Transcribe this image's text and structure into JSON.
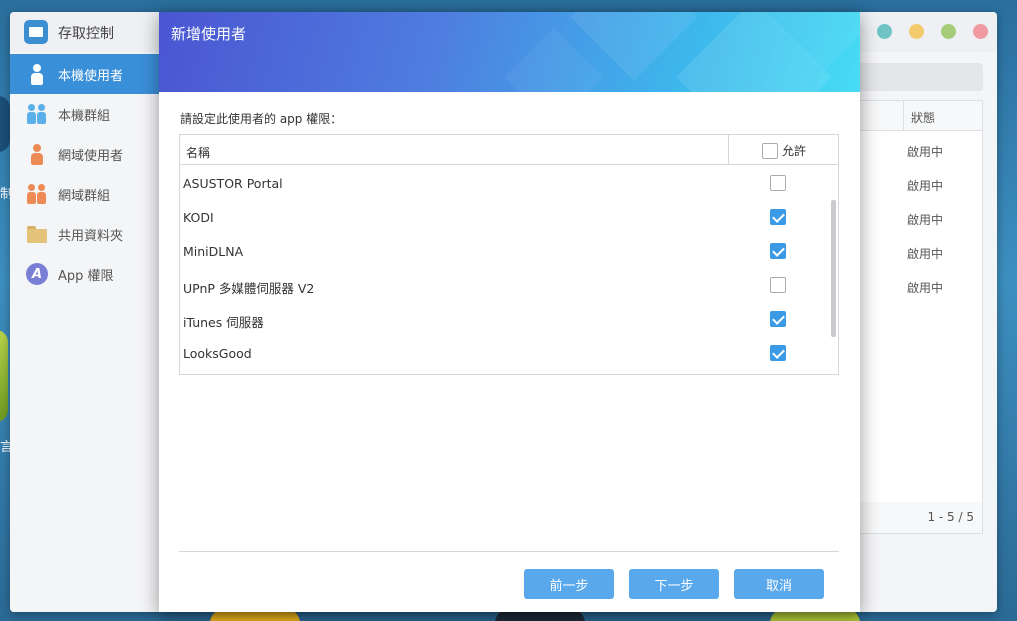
{
  "background_window": {
    "title": "存取控制",
    "sidebar": [
      {
        "label": "本機使用者",
        "icon": "user-icon",
        "active": true
      },
      {
        "label": "本機群組",
        "icon": "group-icon",
        "active": false
      },
      {
        "label": "網域使用者",
        "icon": "domain-user-icon",
        "active": false
      },
      {
        "label": "網域群組",
        "icon": "domain-group-icon",
        "active": false
      },
      {
        "label": "共用資料夾",
        "icon": "folder-icon",
        "active": false
      },
      {
        "label": "App 權限",
        "icon": "app-icon",
        "active": false
      }
    ],
    "table": {
      "status_header": "狀態",
      "rows": [
        "啟用中",
        "啟用中",
        "啟用中",
        "啟用中",
        "啟用中"
      ],
      "pagination": "1 - 5 / 5"
    },
    "desktop_fragments": [
      "制",
      "言"
    ]
  },
  "dialog": {
    "title": "新增使用者",
    "prompt": "請設定此使用者的 app 權限：",
    "table": {
      "name_header": "名稱",
      "allow_header": "允許",
      "allow_all_checked": false,
      "rows": [
        {
          "name": "ASUSTOR Portal",
          "allowed": false
        },
        {
          "name": "KODI",
          "allowed": true
        },
        {
          "name": "MiniDLNA",
          "allowed": true
        },
        {
          "name": "UPnP 多媒體伺服器 V2",
          "allowed": false
        },
        {
          "name": "iTunes 伺服器",
          "allowed": true
        },
        {
          "name": "LooksGood",
          "allowed": true
        }
      ]
    },
    "buttons": {
      "prev": "前一步",
      "next": "下一步",
      "cancel": "取消"
    }
  },
  "colors": {
    "accent": "#3a8fd9",
    "button": "#5aa8ec",
    "checkbox_checked": "#3b9ae6"
  }
}
